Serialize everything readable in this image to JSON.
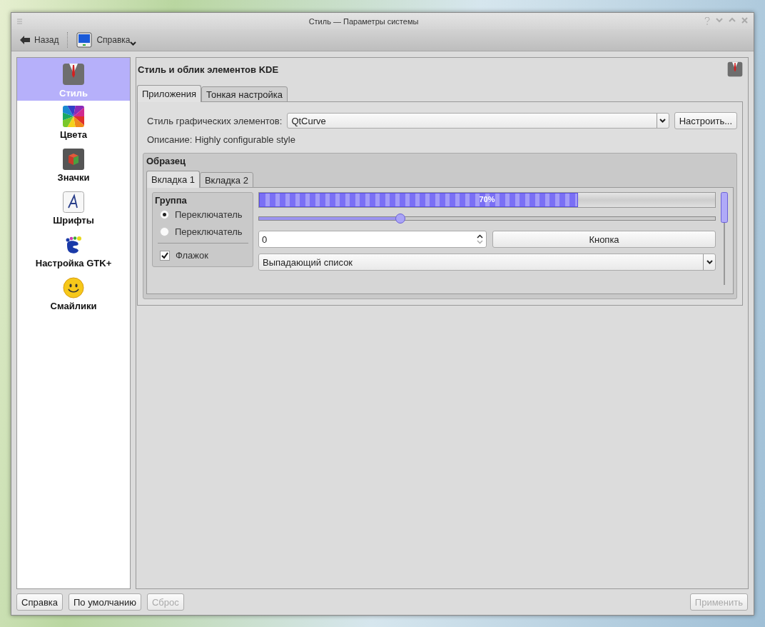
{
  "window": {
    "title": "Стиль — Параметры системы"
  },
  "toolbar": {
    "back": "Назад",
    "help": "Справка"
  },
  "sidebar": {
    "items": [
      {
        "label": "Стиль",
        "selected": true
      },
      {
        "label": "Цвета",
        "selected": false
      },
      {
        "label": "Значки",
        "selected": false
      },
      {
        "label": "Шрифты",
        "selected": false
      },
      {
        "label": "Настройка GTK+",
        "selected": false
      },
      {
        "label": "Смайлики",
        "selected": false
      }
    ]
  },
  "heading": "Стиль и облик элементов KDE",
  "tabs": [
    {
      "label": "Приложения",
      "selected": true
    },
    {
      "label": "Тонкая настройка",
      "selected": false
    }
  ],
  "widget_style": {
    "label": "Стиль графических элементов:",
    "value": "QtCurve",
    "configure": "Настроить..."
  },
  "description": "Описание: Highly configurable style",
  "preview": {
    "title": "Образец",
    "tabs": [
      {
        "label": "Вкладка 1",
        "selected": true
      },
      {
        "label": "Вкладка 2",
        "selected": false
      }
    ],
    "group": {
      "title": "Группа",
      "radios": [
        {
          "label": "Переключатель",
          "selected": true
        },
        {
          "label": "Переключатель",
          "selected": false
        }
      ],
      "checkbox": {
        "label": "Флажок",
        "checked": true
      }
    },
    "progress": {
      "level": 0.7,
      "label": "70%"
    },
    "slider": {
      "level": 0.31
    },
    "spin": {
      "value": "0"
    },
    "button": "Кнопка",
    "combo": "Выпадающий список"
  },
  "footer": [
    {
      "label": "Справка",
      "disabled": false
    },
    {
      "label": "По умолчанию",
      "disabled": false
    },
    {
      "label": "Сброс",
      "disabled": true
    },
    {
      "label": "Применить",
      "disabled": true
    }
  ]
}
